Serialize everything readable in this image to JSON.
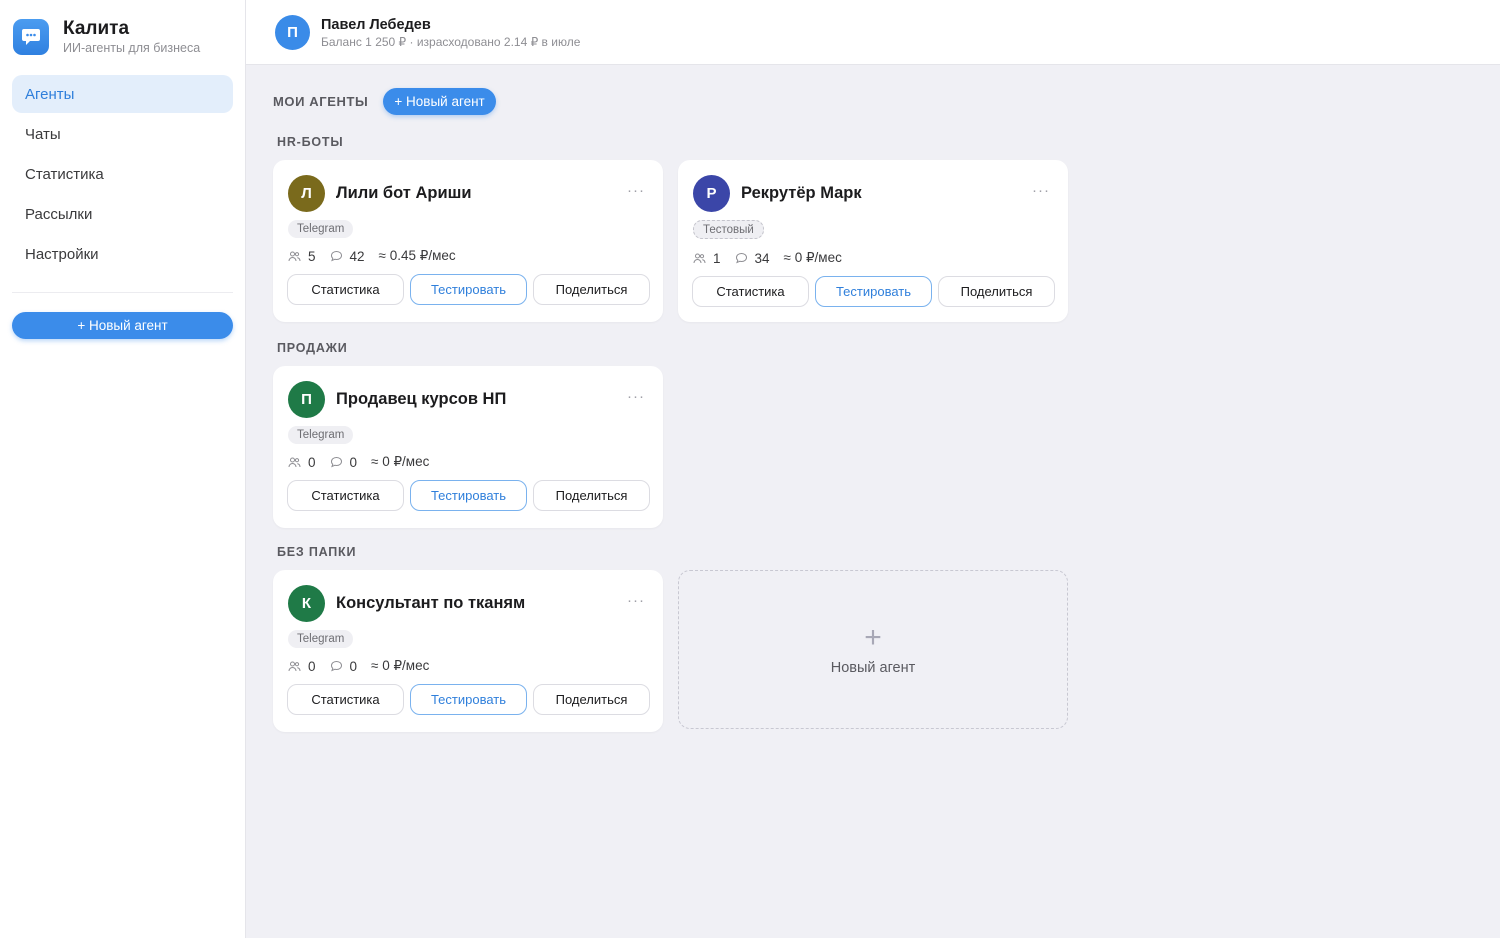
{
  "brand": {
    "title": "Калита",
    "subtitle": "ИИ-агенты для бизнеса",
    "logo_icon": "chat-bubble-icon"
  },
  "nav": {
    "items": [
      {
        "label": "Агенты",
        "active": true
      },
      {
        "label": "Чаты",
        "active": false
      },
      {
        "label": "Статистика",
        "active": false
      },
      {
        "label": "Рассылки",
        "active": false
      },
      {
        "label": "Настройки",
        "active": false
      }
    ],
    "new_agent_label": "+ Новый агент"
  },
  "header": {
    "avatar_letter": "П",
    "user_name": "Павел Лебедев",
    "balance_text": "Баланс 1 250 ₽ · израсходовано 2.14 ₽ в июле"
  },
  "main": {
    "section_title": "МОИ АГЕНТЫ",
    "new_agent_label": "+ Новый агент",
    "folders": [
      {
        "title": "HR-БОТЫ",
        "agents": [
          {
            "letter": "Л",
            "avatar_color": "#7a6a1c",
            "name": "Лили бот Ариши",
            "badge": "Telegram",
            "users": "5",
            "chats": "42",
            "cost": "≈ 0.45 ₽/мес"
          },
          {
            "letter": "Р",
            "avatar_color": "#3b46a8",
            "name": "Рекрутёр Марк",
            "badge": "Тестовый",
            "users": "1",
            "chats": "34",
            "cost": "≈ 0 ₽/мес"
          }
        ]
      },
      {
        "title": "ПРОДАЖИ",
        "agents": [
          {
            "letter": "П",
            "avatar_color": "#1f7a47",
            "name": "Продавец курсов НП",
            "badge": "Telegram",
            "users": "0",
            "chats": "0",
            "cost": "≈ 0 ₽/мес"
          }
        ]
      },
      {
        "title": "БЕЗ ПАПКИ",
        "agents": [
          {
            "letter": "К",
            "avatar_color": "#1f7a47",
            "name": "Консультант по тканям",
            "badge": "Telegram",
            "users": "0",
            "chats": "0",
            "cost": "≈ 0 ₽/мес"
          }
        ]
      }
    ],
    "card_buttons": {
      "stats": "Статистика",
      "test": "Тестировать",
      "share": "Поделиться"
    },
    "menu_glyph": "···",
    "new_agent_card": {
      "plus": "+",
      "label": "Новый агент"
    }
  },
  "colors": {
    "accent": "#3b8cea",
    "active_nav_bg": "#e3eefb",
    "background": "#f0f0f5"
  }
}
